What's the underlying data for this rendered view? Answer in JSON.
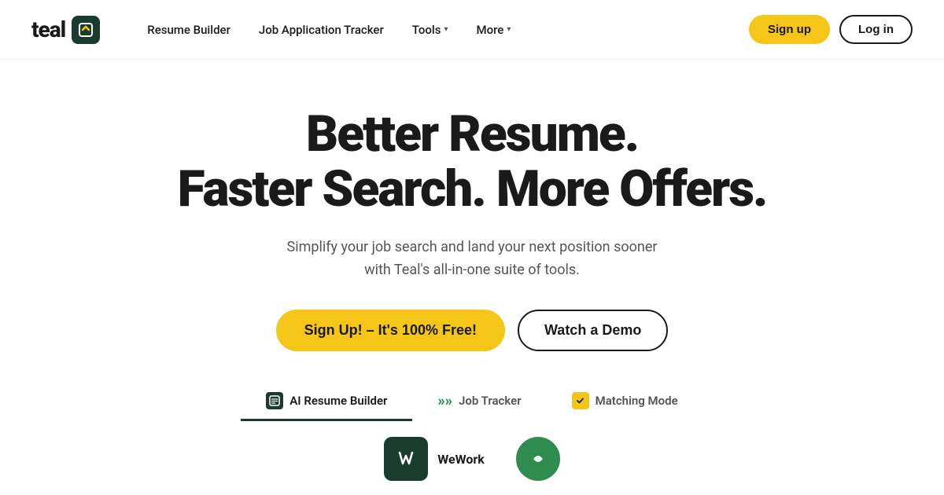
{
  "navbar": {
    "logo_text": "teal",
    "nav_items": [
      {
        "label": "Resume Builder",
        "dropdown": false
      },
      {
        "label": "Job Application Tracker",
        "dropdown": false
      },
      {
        "label": "Tools",
        "dropdown": true
      },
      {
        "label": "More",
        "dropdown": true
      }
    ],
    "signup_label": "Sign up",
    "login_label": "Log in"
  },
  "hero": {
    "title_line1": "Better Resume.",
    "title_line2": "Faster Search. More Offers.",
    "subtitle": "Simplify your job search and land your next position sooner with Teal's all-in-one suite of tools.",
    "cta_primary": "Sign Up! – It's 100% Free!",
    "cta_secondary": "Watch a Demo"
  },
  "tabs": [
    {
      "label": "AI Resume Builder",
      "active": true,
      "icon": "resume-icon"
    },
    {
      "label": "Job Tracker",
      "active": false,
      "icon": "tracker-icon"
    },
    {
      "label": "Matching Mode",
      "active": false,
      "icon": "matching-icon"
    }
  ],
  "preview": {
    "company1": "WeWork",
    "company2": ""
  },
  "colors": {
    "brand_green": "#1a3c2e",
    "brand_yellow": "#f5c518",
    "text_dark": "#1a1a1a",
    "text_gray": "#555555"
  }
}
